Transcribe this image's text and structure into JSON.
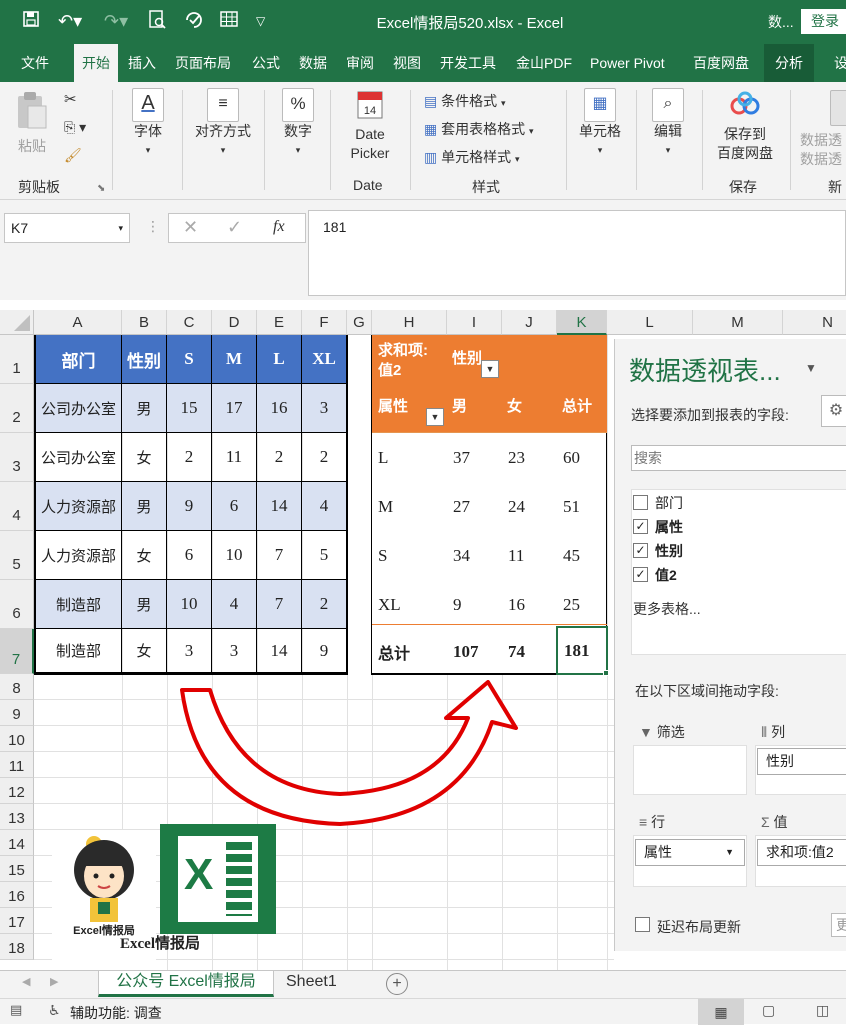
{
  "window": {
    "filename_title": "Excel情报局520.xlsx  -  Excel",
    "account": "数...",
    "login": "登录"
  },
  "tabs": [
    "文件",
    "开始",
    "插入",
    "页面布局",
    "公式",
    "数据",
    "审阅",
    "视图",
    "开发工具",
    "金山PDF",
    "Power Pivot",
    "百度网盘",
    "分析",
    "设"
  ],
  "ribbon": {
    "paste": "粘贴",
    "clipboard_group": "剪贴板",
    "font": "字体",
    "align": "对齐方式",
    "number": "数字",
    "date_picker_1": "Date",
    "date_picker_2": "Picker",
    "date_group": "Date",
    "cond_format": "条件格式",
    "table_format": "套用表格格式",
    "cell_style": "单元格样式",
    "styles_group": "样式",
    "cells": "单元格",
    "edit": "编辑",
    "save_baidu_1": "保存到",
    "save_baidu_2": "百度网盘",
    "save_group": "保存",
    "data_pivot_1": "数据透",
    "data_pivot_2": "数据透",
    "new_group": "新"
  },
  "formula": {
    "name_box": "K7",
    "fx": "fx",
    "value": "181"
  },
  "columns": [
    "A",
    "B",
    "C",
    "D",
    "E",
    "F",
    "G",
    "H",
    "I",
    "J",
    "K",
    "L",
    "M",
    "N"
  ],
  "rows": [
    "1",
    "2",
    "3",
    "4",
    "5",
    "6",
    "7",
    "8",
    "9",
    "10",
    "11",
    "12",
    "13",
    "14",
    "15",
    "16",
    "17",
    "18"
  ],
  "source_table": {
    "headers": [
      "部门",
      "性别",
      "S",
      "M",
      "L",
      "XL"
    ],
    "rows": [
      [
        "公司办公室",
        "男",
        "15",
        "17",
        "16",
        "3"
      ],
      [
        "公司办公室",
        "女",
        "2",
        "11",
        "2",
        "2"
      ],
      [
        "人力资源部",
        "男",
        "9",
        "6",
        "14",
        "4"
      ],
      [
        "人力资源部",
        "女",
        "6",
        "10",
        "7",
        "5"
      ],
      [
        "制造部",
        "男",
        "10",
        "4",
        "7",
        "2"
      ],
      [
        "制造部",
        "女",
        "3",
        "3",
        "14",
        "9"
      ]
    ]
  },
  "pivot": {
    "sum_label_1": "求和项:",
    "sum_label_2": "值2",
    "col_field": "性别",
    "row_field": "属性",
    "col_headers": [
      "男",
      "女",
      "总计"
    ],
    "rows": [
      [
        "L",
        "37",
        "23",
        "60"
      ],
      [
        "M",
        "27",
        "24",
        "51"
      ],
      [
        "S",
        "34",
        "11",
        "45"
      ],
      [
        "XL",
        "9",
        "16",
        "25"
      ]
    ],
    "total": [
      "总计",
      "107",
      "74",
      "181"
    ]
  },
  "logo": {
    "caption": "Excel情报局",
    "badge": "Excel情报局",
    "x_letter": "X"
  },
  "pane": {
    "title": "数据透视表...",
    "choose_fields": "选择要添加到报表的字段:",
    "search": "搜索",
    "fields": [
      {
        "label": "部门",
        "checked": false
      },
      {
        "label": "属性",
        "checked": true
      },
      {
        "label": "性别",
        "checked": true
      },
      {
        "label": "值2",
        "checked": true
      }
    ],
    "more_tables": "更多表格...",
    "drag_hint": "在以下区域间拖动字段:",
    "filter": "筛选",
    "columns": "列",
    "rows": "行",
    "values": "值",
    "col_item": "性别",
    "row_item": "属性",
    "val_item": "求和项:值2",
    "defer": "延迟布局更新",
    "update": "更"
  },
  "sheets": [
    "公众号 Excel情报局",
    "Sheet1"
  ],
  "status": {
    "accessibility": "辅助功能: 调查"
  },
  "colors": {
    "excel_green": "#217346",
    "header_blue": "#4472c4",
    "band_blue": "#d9e1f2",
    "pivot_orange": "#ed7d31",
    "arrow_red": "#e00000"
  }
}
